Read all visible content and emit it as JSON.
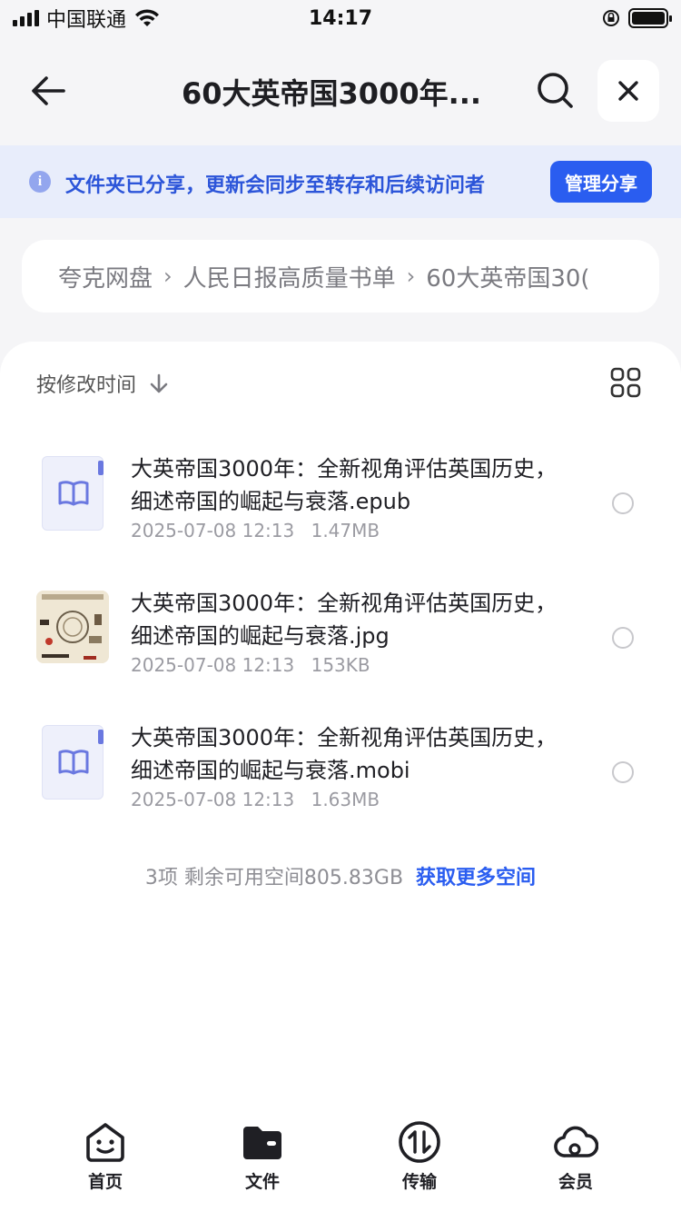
{
  "status_bar": {
    "carrier": "中国联通",
    "time": "14:17"
  },
  "header": {
    "title": "60大英帝国3000年..."
  },
  "share_banner": {
    "text": "文件夹已分享，更新会同步至转存和后续访问者",
    "button_label": "管理分享"
  },
  "breadcrumb": {
    "items": [
      "夸克网盘",
      "人民日报高质量书单",
      "60大英帝国30("
    ],
    "separator": "›"
  },
  "toolbar": {
    "sort_label": "按修改时间"
  },
  "files": [
    {
      "name": "大英帝国3000年：全新视角评估英国历史，细述帝国的崛起与衰落.epub",
      "date": "2025-07-08 12:13",
      "size": "1.47MB",
      "kind": "ebook"
    },
    {
      "name": "大英帝国3000年：全新视角评估英国历史，细述帝国的崛起与衰落.jpg",
      "date": "2025-07-08 12:13",
      "size": "153KB",
      "kind": "image"
    },
    {
      "name": "大英帝国3000年：全新视角评估英国历史，细述帝国的崛起与衰落.mobi",
      "date": "2025-07-08 12:13",
      "size": "1.63MB",
      "kind": "ebook"
    }
  ],
  "footer": {
    "summary": "3项 剩余可用空间805.83GB",
    "link": "获取更多空间"
  },
  "tabbar": {
    "items": [
      {
        "label": "首页",
        "icon": "home-smile-icon"
      },
      {
        "label": "文件",
        "icon": "folder-icon"
      },
      {
        "label": "传输",
        "icon": "transfer-icon"
      },
      {
        "label": "会员",
        "icon": "cloud-vip-icon"
      }
    ]
  },
  "colors": {
    "accent": "#2a5df0",
    "banner_bg": "#e8edfb",
    "page_bg": "#f5f5f7"
  }
}
